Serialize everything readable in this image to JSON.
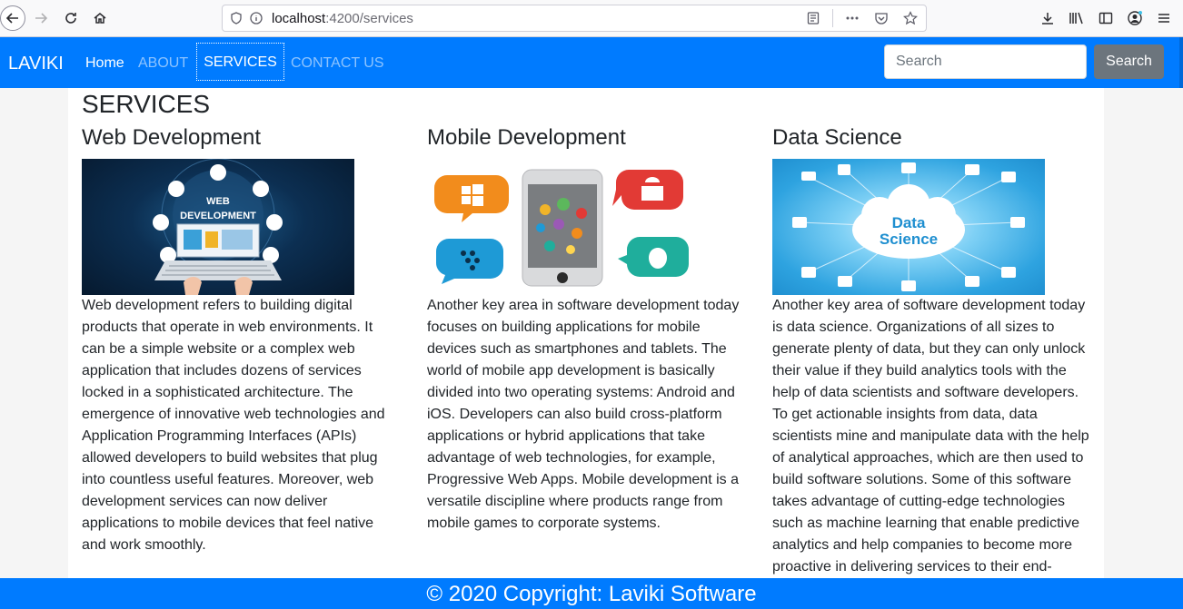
{
  "browser": {
    "url_host": "localhost",
    "url_rest": ":4200/services"
  },
  "navbar": {
    "brand": "LAVIKI",
    "links": [
      {
        "label": "Home"
      },
      {
        "label": "ABOUT"
      },
      {
        "label": "SERVICES"
      },
      {
        "label": "CONTACT US"
      }
    ],
    "search_placeholder": "Search",
    "search_button": "Search"
  },
  "page": {
    "title": "SERVICES",
    "services": [
      {
        "heading": "Web Development",
        "image_text": [
          "WEB",
          "DEVELOPMENT"
        ],
        "body": "Web development refers to building digital products that operate in web environments. It can be a simple website or a complex web application that includes dozens of services locked in a sophisticated architecture. The emergence of innovative web technologies and Application Programming Interfaces (APIs) allowed developers to build websites that plug into countless useful features. Moreover, web development services can now deliver applications to mobile devices that feel native and work smoothly."
      },
      {
        "heading": "Mobile Development",
        "body": "Another key area in software development today focuses on building applications for mobile devices such as smartphones and tablets. The world of mobile app development is basically divided into two operating systems: Android and iOS. Developers can also build cross-platform applications or hybrid applications that take advantage of web technologies, for example, Progressive Web Apps. Mobile development is a versatile discipline where products range from mobile games to corporate systems."
      },
      {
        "heading": "Data Science",
        "image_text": [
          "Data",
          "Science"
        ],
        "body": "Another key area of software development today is data science. Organizations of all sizes to generate plenty of data, but they can only unlock their value if they build analytics tools with the help of data scientists and software developers. To get actionable insights from data, data scientists mine and manipulate data with the help of analytical approaches, which are then used to build software solutions. Some of this software takes advantage of cutting-edge technologies such as machine learning that enable predictive analytics and help companies to become more proactive in delivering services to their end-"
      }
    ]
  },
  "footer": {
    "text": "© 2020 Copyright: Laviki Software"
  },
  "colors": {
    "primary": "#007bff",
    "secondary": "#6c757d"
  }
}
